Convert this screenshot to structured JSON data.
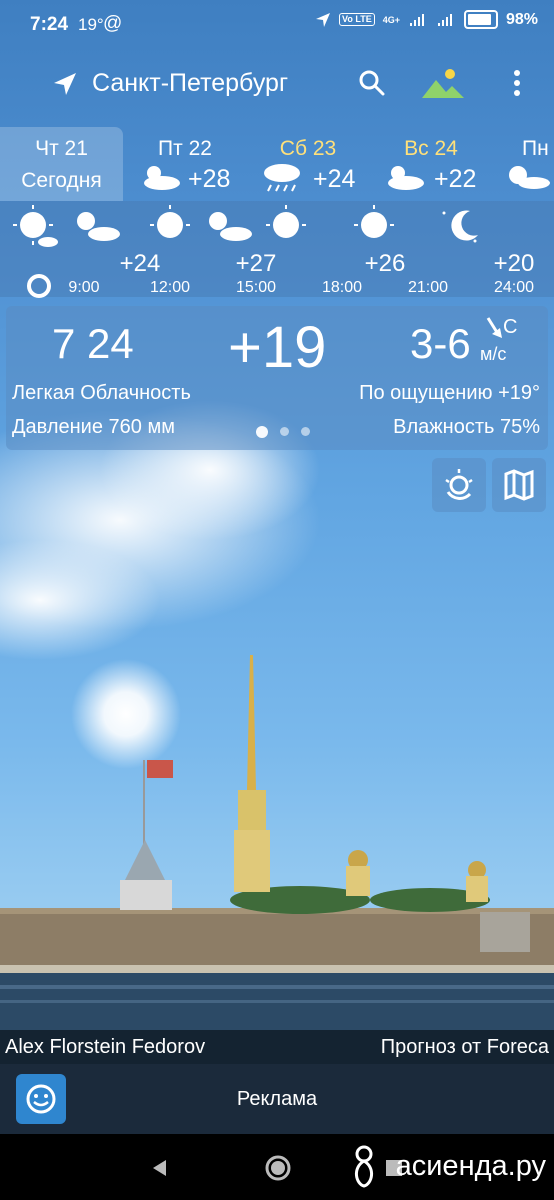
{
  "status": {
    "time": "7:24",
    "temp": "19°",
    "at": "@",
    "network": "4G+",
    "volte": "Vo LTE",
    "battery": "98%"
  },
  "header": {
    "city": "Санкт-Петербург"
  },
  "days": [
    {
      "name": "Чт 21",
      "sub": "Сегодня",
      "selected": true
    },
    {
      "name": "Пт 22",
      "temp": "+28",
      "weekend": false
    },
    {
      "name": "Сб 23",
      "temp": "+24",
      "weekend": true
    },
    {
      "name": "Вс 24",
      "temp": "+22",
      "weekend": true
    },
    {
      "name": "Пн"
    }
  ],
  "hourly": {
    "temps": [
      "+24",
      "+27",
      "+26",
      "+20"
    ],
    "times": [
      "9:00",
      "12:00",
      "15:00",
      "18:00",
      "21:00",
      "24:00"
    ]
  },
  "current": {
    "time": "7 24",
    "temp": "+19",
    "wind": "3-6",
    "wind_dir": "С",
    "wind_unit": "м/с",
    "condition": "Легкая Облачность",
    "feels": "По ощущению +19°",
    "pressure": "Давление 760 мм",
    "humidity": "Влажность 75%"
  },
  "credit": {
    "left": "Alex Florstein Fedorov",
    "right": "Прогноз от Foreca"
  },
  "ad": {
    "label": "Реклама"
  },
  "watermark": "асиенда.ру"
}
